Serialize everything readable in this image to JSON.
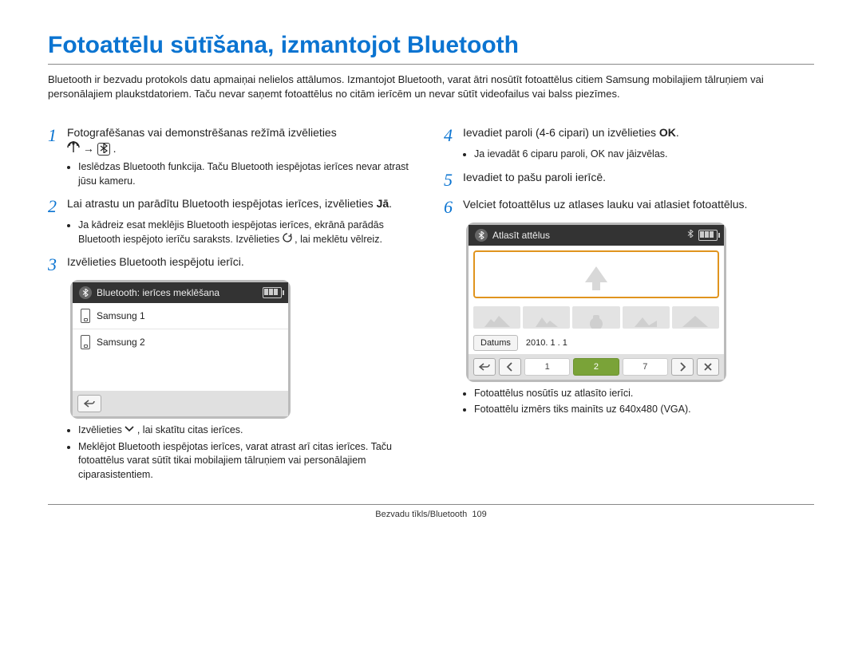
{
  "title": "Fotoattēlu sūtīšana, izmantojot Bluetooth",
  "intro": "Bluetooth ir bezvadu protokols datu apmaiņai nelielos attālumos. Izmantojot Bluetooth, varat ātri nosūtīt fotoattēlus citiem Samsung mobilajiem tālruņiem vai personālajiem plaukstdatoriem. Taču nevar saņemt fotoattēlus no citām ierīcēm un nevar sūtīt videofailus vai balss piezīmes.",
  "left": {
    "step1": {
      "num": "1",
      "text_a": "Fotografēšanas vai demonstrēšanas režīmā izvēlieties",
      "arrow": "→",
      "sub1": "Ieslēdzas Bluetooth funkcija. Taču Bluetooth iespējotas ierīces nevar atrast jūsu kameru."
    },
    "step2": {
      "num": "2",
      "text_a": "Lai atrastu un parādītu Bluetooth iespējotas ierīces, izvēlieties ",
      "text_b": "Jā",
      "sub1_a": "Ja kādreiz esat meklējis Bluetooth iespējotas ierīces, ekrānā parādās Bluetooth iespējoto ierīču saraksts. Izvēlieties ",
      "sub1_b": ", lai meklētu vēlreiz."
    },
    "step3": {
      "num": "3",
      "text": "Izvēlieties Bluetooth iespējotu ierīci.",
      "shot_header": "Bluetooth: ierīces meklēšana",
      "dev1": "Samsung 1",
      "dev2": "Samsung 2",
      "sub1": "Izvēlieties      , lai skatītu citas ierīces.",
      "sub2": "Meklējot Bluetooth iespējotas ierīces, varat atrast arī citas ierīces. Taču fotoattēlus varat sūtīt tikai mobilajiem tālruņiem vai personālajiem ciparasistentiem."
    }
  },
  "right": {
    "step4": {
      "num": "4",
      "text_a": "Ievadiet paroli (4-6 cipari) un izvēlieties ",
      "text_b": "OK",
      "sub1_a": "Ja ievadāt 6 ciparu paroli, ",
      "sub1_b": "OK",
      "sub1_c": " nav jāizvēlas."
    },
    "step5": {
      "num": "5",
      "text": "Ievadiet to pašu paroli ierīcē."
    },
    "step6": {
      "num": "6",
      "text": "Velciet fotoattēlus uz atlases lauku vai atlasiet fotoattēlus.",
      "shot_header": "Atlasīt attēlus",
      "date_btn": "Datums",
      "date_val": "2010. 1 . 1",
      "pager": {
        "a": "1",
        "b": "2",
        "c": "7"
      },
      "sub1": "Fotoattēlus nosūtīs uz atlasīto ierīci.",
      "sub2": "Fotoattēlu izmērs tiks mainīts uz 640x480 (VGA)."
    }
  },
  "footer": {
    "section": "Bezvadu tīkls/Bluetooth",
    "page": "109"
  }
}
